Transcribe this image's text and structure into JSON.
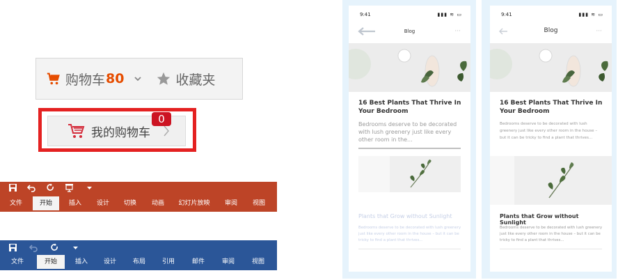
{
  "cart_bar": {
    "label": "购物车",
    "count": "80",
    "favorites": "收藏夹",
    "accent": "#e64d00"
  },
  "my_cart": {
    "label": "我的购物车",
    "badge": "0",
    "border": "#e42121"
  },
  "ppt_ribbon": {
    "color": "#bd4427",
    "tabs": [
      "文件",
      "开始",
      "插入",
      "设计",
      "切换",
      "动画",
      "幻灯片放映",
      "审阅",
      "视图"
    ],
    "active": "开始"
  },
  "word_ribbon": {
    "color": "#2b5698",
    "tabs": [
      "文件",
      "开始",
      "插入",
      "设计",
      "布局",
      "引用",
      "邮件",
      "审阅",
      "视图"
    ],
    "active": "开始"
  },
  "phone_left": {
    "time": "9:41",
    "title": "Blog",
    "heading": "16 Best Plants That Thrive In Your Bedroom",
    "excerpt": "Bedrooms deserve to be decorated with lush greenery just like every other room in the...",
    "subheading": "Plants that Grow without Sunlight",
    "subtext": "Bedrooms deserve to be decorated with lush greenery just like every other room in the house – but it can be tricky to find a plant that thrives..."
  },
  "phone_right": {
    "time": "9:41",
    "title": "Blog",
    "heading": "16 Best Plants That Thrive In Your Bedroom",
    "excerpt": "Bedrooms deserve to be decorated with lush greenery just like every other room in the house – but it can be tricky to find a plant that thrives...",
    "subheading": "Plants that Grow without Sunlight",
    "subtext": "Bedrooms deserve to be decorated with lush greenery just like every other room in the house – but it can be tricky to find a plant that thrives..."
  }
}
